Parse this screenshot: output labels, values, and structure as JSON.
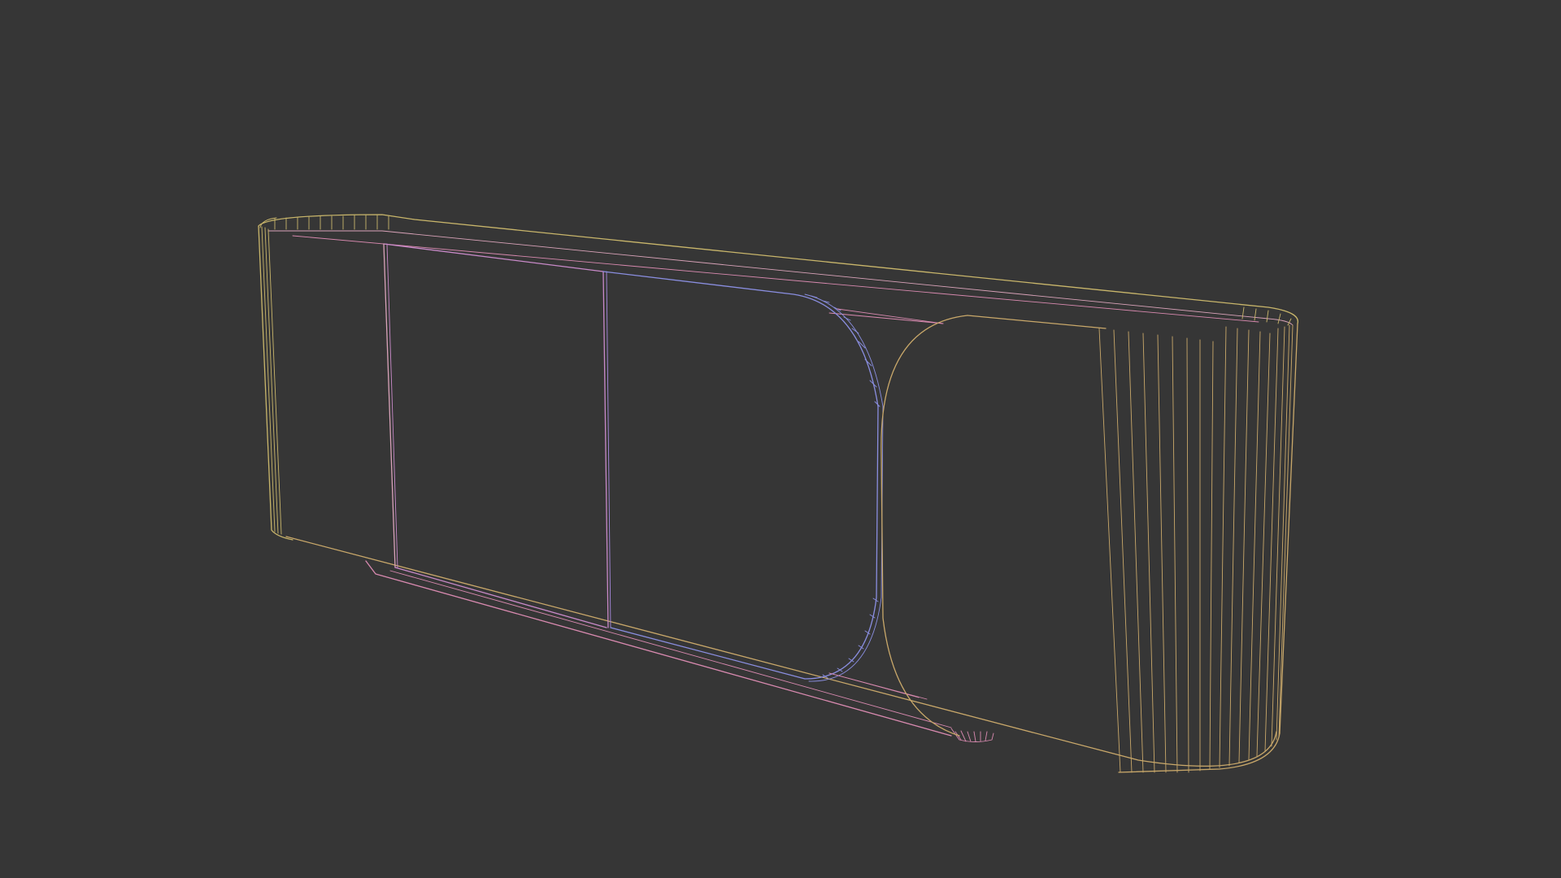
{
  "viewport": {
    "background_color": "#363636",
    "render_mode": "wireframe"
  },
  "model": {
    "object": "sideboard",
    "parts": [
      "carcass-shell",
      "left-door",
      "center-door",
      "right-door-rounded",
      "fluted-end-panel",
      "base-plinth",
      "foot"
    ],
    "wire_colors": {
      "shell": "#c9b66b",
      "outline": "#c9a86a",
      "doors": "#c98ac9",
      "door_accent": "#8a8ee0",
      "base": "#d98ab0",
      "flutes": "#c9a86a"
    }
  }
}
